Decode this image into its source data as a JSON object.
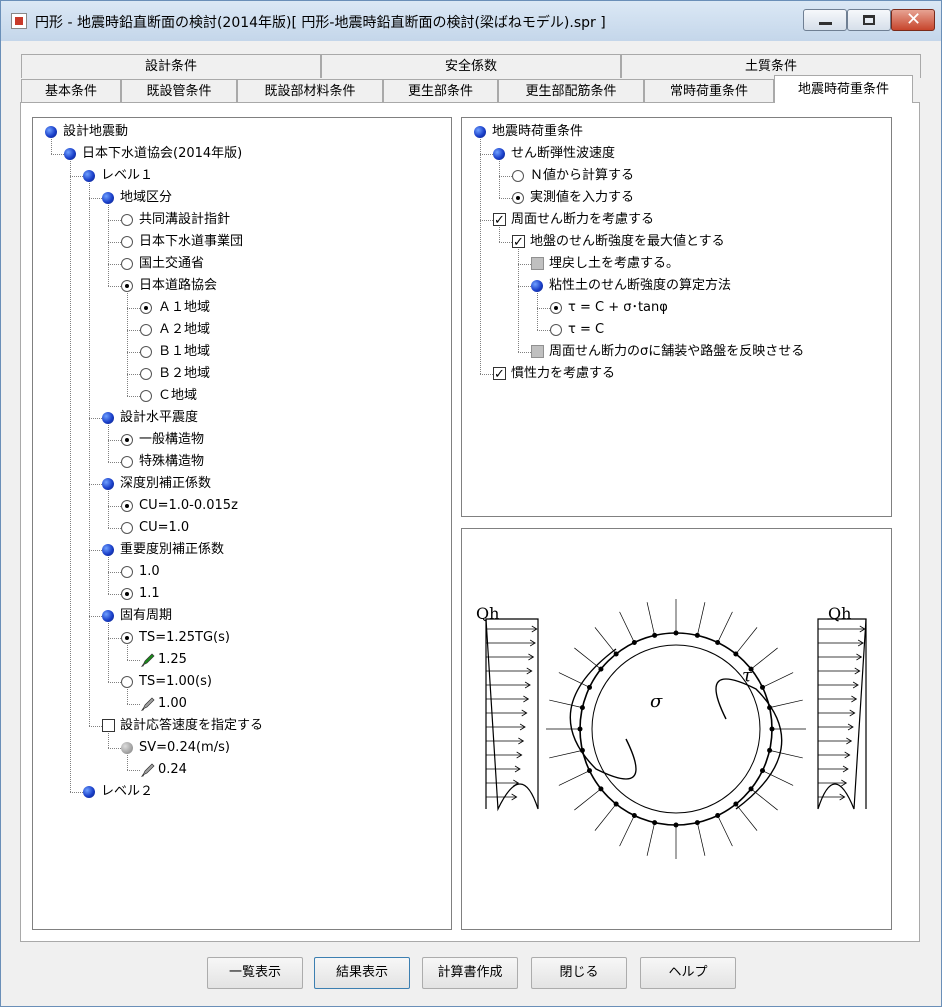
{
  "window": {
    "title": "円形 - 地震時鉛直断面の検討(2014年版)[ 円形-地震時鉛直断面の検討(梁ばねモデル).spr ]"
  },
  "tabs_top": [
    {
      "label": "設計条件"
    },
    {
      "label": "安全係数"
    },
    {
      "label": "土質条件"
    }
  ],
  "tabs_bottom": [
    {
      "label": "基本条件"
    },
    {
      "label": "既設管条件"
    },
    {
      "label": "既設部材料条件"
    },
    {
      "label": "更生部条件"
    },
    {
      "label": "更生部配筋条件"
    },
    {
      "label": "常時荷重条件"
    },
    {
      "label": "地震時荷重条件"
    }
  ],
  "left_tree": [
    {
      "text": "設計地震動",
      "icon": "dot"
    },
    {
      "text": "日本下水道協会(2014年版)",
      "icon": "dot"
    },
    {
      "text": "レベル１",
      "icon": "dot"
    },
    {
      "text": "地域区分",
      "icon": "dot"
    },
    {
      "text": "共同溝設計指針",
      "icon": "radio"
    },
    {
      "text": "日本下水道事業団",
      "icon": "radio"
    },
    {
      "text": "国土交通省",
      "icon": "radio"
    },
    {
      "text": "日本道路協会",
      "icon": "radio-on"
    },
    {
      "text": "Ａ１地域",
      "icon": "radio-on"
    },
    {
      "text": "Ａ２地域",
      "icon": "radio"
    },
    {
      "text": "Ｂ１地域",
      "icon": "radio"
    },
    {
      "text": "Ｂ２地域",
      "icon": "radio"
    },
    {
      "text": "Ｃ地域",
      "icon": "radio"
    },
    {
      "text": "設計水平震度",
      "icon": "dot"
    },
    {
      "text": "一般構造物",
      "icon": "radio-on"
    },
    {
      "text": "特殊構造物",
      "icon": "radio"
    },
    {
      "text": "深度別補正係数",
      "icon": "dot"
    },
    {
      "text": "CU=1.0-0.015z",
      "icon": "radio-on"
    },
    {
      "text": "CU=1.0",
      "icon": "radio"
    },
    {
      "text": "重要度別補正係数",
      "icon": "dot"
    },
    {
      "text": "1.0",
      "icon": "radio"
    },
    {
      "text": "1.1",
      "icon": "radio-on"
    },
    {
      "text": "固有周期",
      "icon": "dot"
    },
    {
      "text": "TS=1.25TG(s)",
      "icon": "radio-on"
    },
    {
      "text": "1.25",
      "icon": "pencil-active"
    },
    {
      "text": "TS=1.00(s)",
      "icon": "radio"
    },
    {
      "text": "1.00",
      "icon": "pencil-gray"
    },
    {
      "text": "設計応答速度を指定する",
      "icon": "check"
    },
    {
      "text": "SV=0.24(m/s)",
      "icon": "gray-dot"
    },
    {
      "text": "0.24",
      "icon": "pencil-gray"
    },
    {
      "text": "レベル２",
      "icon": "dot"
    }
  ],
  "right_tree": [
    {
      "text": "地震時荷重条件",
      "icon": "dot"
    },
    {
      "text": "せん断弾性波速度",
      "icon": "dot"
    },
    {
      "text": "Ｎ値から計算する",
      "icon": "radio"
    },
    {
      "text": "実測値を入力する",
      "icon": "radio-on"
    },
    {
      "text": "周面せん断力を考慮する",
      "icon": "check-on"
    },
    {
      "text": "地盤のせん断強度を最大値とする",
      "icon": "check-on"
    },
    {
      "text": "埋戻し土を考慮する。",
      "icon": "check-dis"
    },
    {
      "text": "粘性土のせん断強度の算定方法",
      "icon": "dot"
    },
    {
      "text": "τ = C + σ･tanφ",
      "icon": "radio-on"
    },
    {
      "text": "τ = C",
      "icon": "radio"
    },
    {
      "text": "周面せん断力のσに舗装や路盤を反映させる",
      "icon": "check-dis"
    },
    {
      "text": "慣性力を考慮する",
      "icon": "check-on"
    }
  ],
  "diagram": {
    "label_left": "Qh",
    "label_right": "Qh",
    "label_sigma": "σ",
    "label_tau": "τ"
  },
  "buttons": [
    {
      "label": "一覧表示"
    },
    {
      "label": "結果表示"
    },
    {
      "label": "計算書作成"
    },
    {
      "label": "閉じる"
    },
    {
      "label": "ヘルプ"
    }
  ]
}
